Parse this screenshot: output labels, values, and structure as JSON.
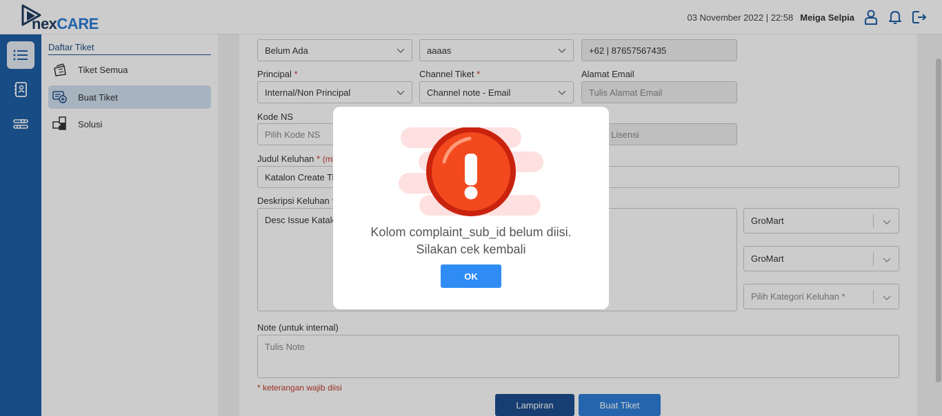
{
  "header": {
    "logo_nex": "nex",
    "logo_care": "CARE",
    "datetime": "03 November 2022 | 22:58",
    "user_name": "Meiga Selpia",
    "icons": [
      "user-icon",
      "bell-icon",
      "logout-icon"
    ]
  },
  "rail": {
    "items": [
      {
        "icon": "list-icon",
        "active": true
      },
      {
        "icon": "contacts-book-icon",
        "active": false
      },
      {
        "icon": "sliders-icon",
        "active": false
      }
    ]
  },
  "subnav": {
    "title": "Daftar Tiket",
    "items": [
      {
        "label": "Tiket Semua",
        "icon": "ticket-stack-icon",
        "active": false
      },
      {
        "label": "Buat Tiket",
        "icon": "ticket-add-icon",
        "active": true
      },
      {
        "label": "Solusi",
        "icon": "puzzle-icon",
        "active": false
      }
    ]
  },
  "form": {
    "distributor": {
      "value": "Belum Ada"
    },
    "pic": {
      "value": "aaaas"
    },
    "telepon": {
      "value": "+62 | 87657567435"
    },
    "principal": {
      "label": "Principal",
      "required": "*",
      "value": "Internal/Non Principal"
    },
    "channel": {
      "label": "Channel Tiket",
      "required": "*",
      "value": "Channel note - Email"
    },
    "email": {
      "label": "Alamat Email",
      "placeholder": "Tulis Alamat Email"
    },
    "kode_ns": {
      "label": "Kode NS",
      "placeholder": "Pilih Kode NS"
    },
    "lisensi": {
      "placeholder_visible": "s Lisensi"
    },
    "judul": {
      "label": "Judul Keluhan",
      "required": "*",
      "hint": "(min",
      "value": "Katalon Create Tic"
    },
    "deskripsi": {
      "label": "Deskripsi Keluhan",
      "required": "*",
      "value": "Desc Issue Katalo"
    },
    "selects": [
      {
        "value": "GroMart"
      },
      {
        "value": "GroMart"
      },
      {
        "value": "Pilih Kategori Keluhan *",
        "placeholder": true
      }
    ],
    "note": {
      "label": "Note (untuk internal)",
      "placeholder": "Tulis Note"
    },
    "required_note": "* keterangan wajib diisi",
    "buttons": {
      "lampiran": "Lampiran",
      "buat_tiket": "Buat Tiket"
    },
    "colors": {
      "lampiran": "#1d4e8f",
      "buat_tiket": "#2f7fd9"
    }
  },
  "modal": {
    "icon": "error-exclamation-icon",
    "message_line1": "Kolom complaint_sub_id belum diisi.",
    "message_line2": "Silakan cek kembali",
    "ok_label": "OK",
    "ok_color": "#2f8cf5"
  }
}
